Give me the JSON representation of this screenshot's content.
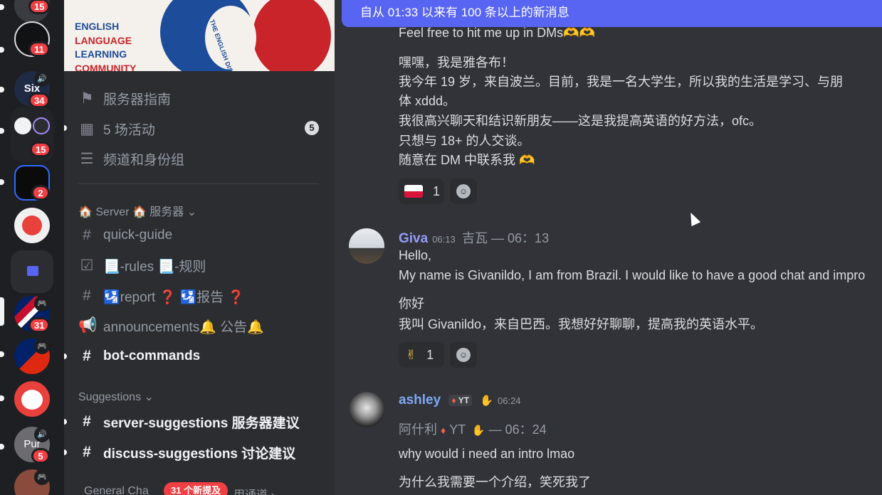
{
  "rail": {
    "servers": [
      {
        "name": "server-1",
        "badge": "15",
        "color": "#3a3c41"
      },
      {
        "name": "server-2",
        "badge": "11",
        "color": "#111214"
      },
      {
        "name": "server-3",
        "badge": "34",
        "color": "#1f2a44",
        "label": "Six"
      },
      {
        "name": "server-4",
        "badge": "15",
        "color": "#101010"
      },
      {
        "name": "server-5",
        "badge": "2",
        "color": "#0b0b0b"
      },
      {
        "name": "server-6",
        "badge": "",
        "color": "#f0f0f0"
      },
      {
        "name": "server-uk",
        "badge": "31",
        "color": "#c8102e"
      },
      {
        "name": "server-uk-cn",
        "badge": "",
        "color": "#de2910"
      },
      {
        "name": "server-anime",
        "badge": "",
        "color": "#e8413c"
      },
      {
        "name": "server-pure",
        "badge": "5",
        "color": "#6b6b70",
        "label": "Pur"
      }
    ]
  },
  "sidebar": {
    "banner": {
      "lines": [
        "ENGLISH",
        "LANGUAGE",
        "LEARNING",
        "COMMUNITY"
      ],
      "logo_text": "THE ENGLISH DISCORD SERVER"
    },
    "top_items": [
      {
        "label": "服务器指南",
        "icon": "signpost-icon"
      },
      {
        "label": "5 场活动",
        "icon": "calendar-icon",
        "count": "5"
      },
      {
        "label": "频道和身份组",
        "icon": "channels-roles-icon"
      }
    ],
    "category_server": "🏠 Server 🏠 服务器 ⌄",
    "channels": [
      {
        "label": "quick-guide",
        "icon": "#"
      },
      {
        "label": "📃-rules 📃-规则",
        "icon": "☑"
      },
      {
        "label": "🛂report ❓ 🛂报告 ❓",
        "icon": "#"
      },
      {
        "label": "announcements🔔 公告🔔",
        "icon": "📢"
      },
      {
        "label": "bot-commands",
        "icon": "#"
      }
    ],
    "category_suggestions": "Suggestions ⌄",
    "suggestion_channels": [
      {
        "label": "server-suggestions 服务器建议",
        "icon": "#"
      },
      {
        "label": "discuss-suggestions 讨论建议",
        "icon": "#"
      }
    ],
    "category_general": "General Cha",
    "category_general_rest": "用通道 ›",
    "new_mentions": "31 个新提及"
  },
  "main": {
    "new_messages_bar": "自从 01:33 以来有 100 条以上的新消息",
    "msg1_lines": [
      "Feel free to hit me up in DMs🫶🫶",
      "嘿嘿，我是雅各布！",
      "我今年 19 岁，来自波兰。目前，我是一名大学生，所以我的生活是学习、与朋",
      "体 xddd。",
      "我很高兴聊天和结识新朋友——这是我提高英语的好方法，ofc。",
      "只想与 18+ 的人交谈。",
      "随意在 DM 中联系我 🫶"
    ],
    "msg1_reaction_count": "1",
    "msg2": {
      "author": "Giva",
      "time": "06:13",
      "author_translated": "吉瓦 — 06：13",
      "lines": [
        "Hello,",
        "My name is Givanildo, I am from Brazil. I would like to have a good chat and impro"
      ],
      "translated_lines": [
        "你好",
        "我叫 Givanildo，来自巴西。我想好好聊聊，提高我的英语水平。"
      ],
      "reaction_emoji": "✌",
      "reaction_count": "1",
      "author_color": "#949cf7"
    },
    "msg3": {
      "author": "ashley",
      "tag": "YT",
      "time": "06:24",
      "author_translated": "阿什利",
      "tag_translated": "YT",
      "time_translated": "— 06：24",
      "lines": [
        "why would i need an intro lmao",
        "为什么我需要一个介绍，笑死我了"
      ],
      "author_color": "#7ea6f2"
    }
  }
}
